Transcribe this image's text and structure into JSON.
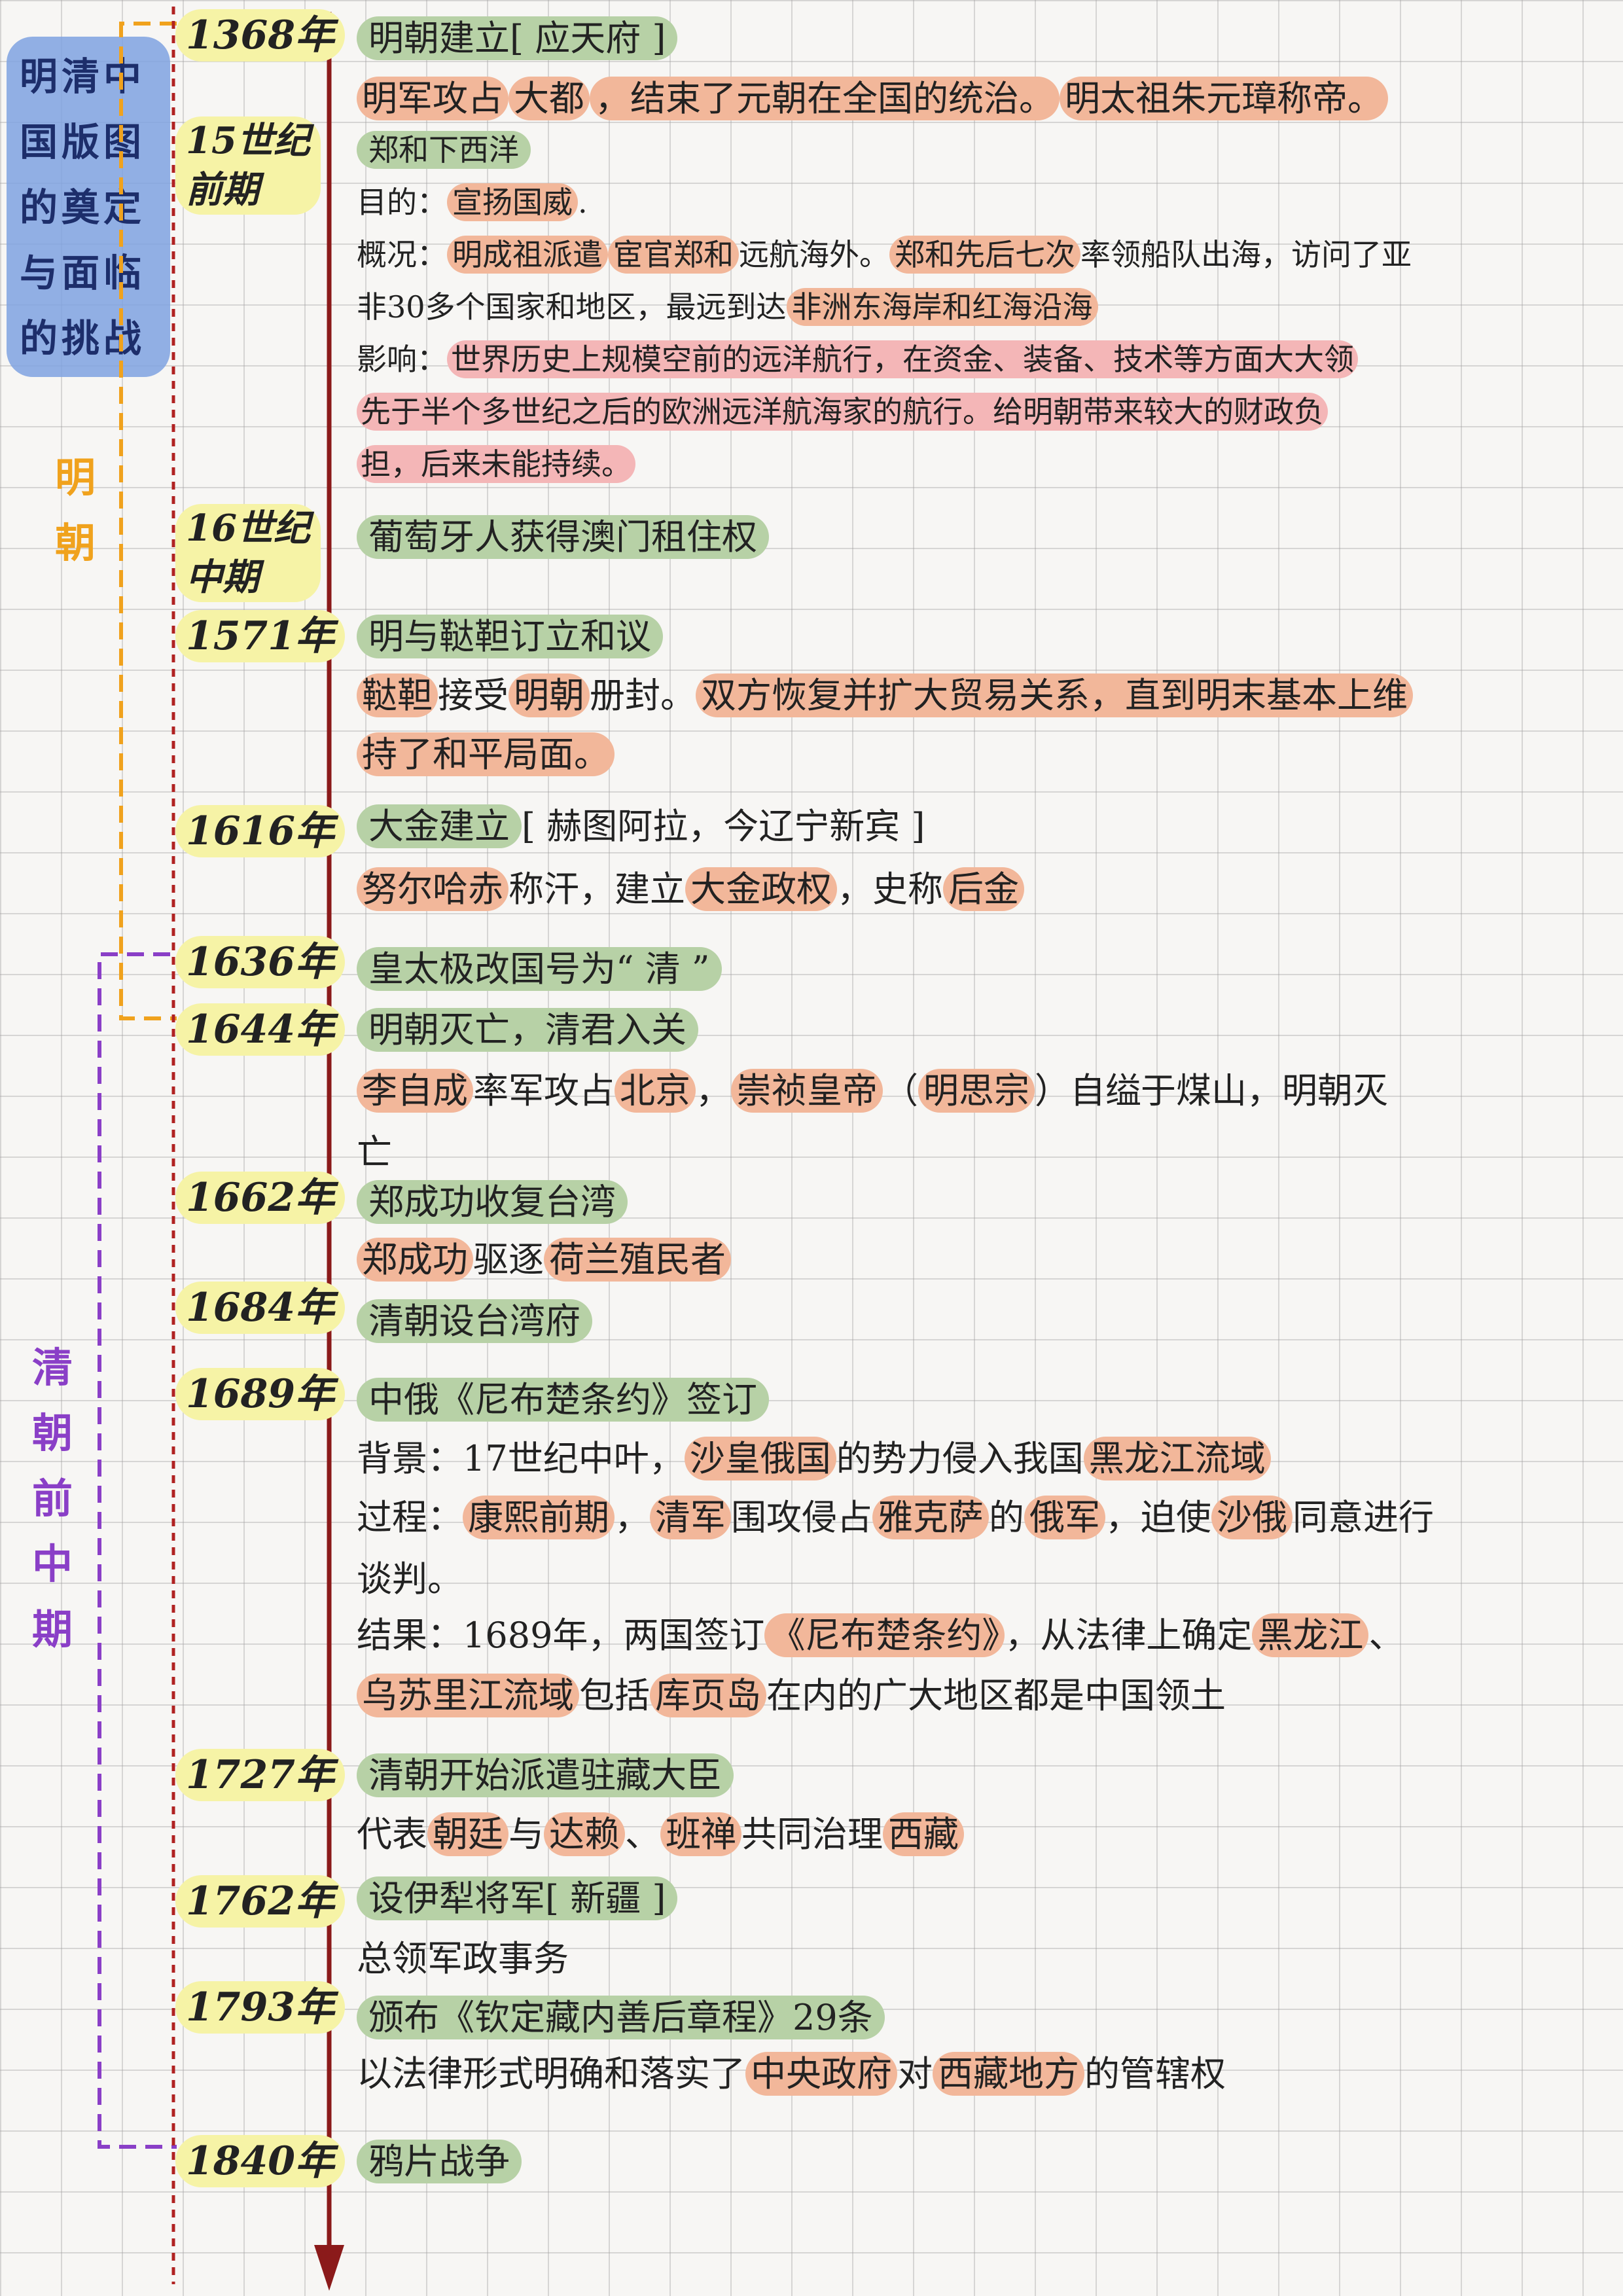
{
  "title": [
    "明清中",
    "国版图",
    "的奠定",
    "与面临",
    "的挑战"
  ],
  "eras": {
    "ming": "明\n朝",
    "qing": "清\n朝\n前\n中\n期"
  },
  "colors": {
    "ming_bracket": "#f0a21d",
    "qing_bracket": "#8a3fc7",
    "axis": "#8b1a1a",
    "green": "#b7d1a6",
    "orange": "#f2b79a",
    "pink": "#f4b6b7",
    "date_bg": "#f6f3a6",
    "title_bg": "#7fa2e0"
  },
  "dates": [
    "1368年",
    "15世纪\n前期",
    "16世纪\n中期",
    "1571年",
    "1616年",
    "1636年",
    "1644年",
    "1662年",
    "1684年",
    "1689年",
    "1727年",
    "1762年",
    "1793年",
    "1840年"
  ],
  "lines": [
    [
      {
        "t": "明朝建立[ 应天府 ]",
        "h": "g"
      }
    ],
    [
      {
        "t": "明军攻占",
        "h": "o"
      },
      {
        "t": "大都",
        "h": "o"
      },
      {
        "t": "，结束了元朝在全国的统治。",
        "h": "o"
      },
      {
        "t": "明太祖朱元璋称帝。",
        "h": "o"
      }
    ],
    [
      {
        "t": "郑和下西洋",
        "h": "g"
      }
    ],
    [
      {
        "t": "目的：",
        "h": ""
      },
      {
        "t": "宣扬国威",
        "h": "o"
      },
      {
        "t": ".",
        "h": ""
      }
    ],
    [
      {
        "t": "概况：",
        "h": ""
      },
      {
        "t": "明成祖派遣",
        "h": "o"
      },
      {
        "t": "宦官郑和",
        "h": "o"
      },
      {
        "t": "远航海外。",
        "h": ""
      },
      {
        "t": "郑和先后七次",
        "h": "o"
      },
      {
        "t": "率领船队出海，访问了亚",
        "h": ""
      }
    ],
    [
      {
        "t": "非30多个国家和地区，最远到达",
        "h": ""
      },
      {
        "t": "非洲东海岸和红海沿海",
        "h": "o"
      }
    ],
    [
      {
        "t": "影响：",
        "h": ""
      },
      {
        "t": "世界历史上规模空前的远洋航行，在资金、装备、技术等方面大大领",
        "h": "p"
      }
    ],
    [
      {
        "t": "先于半个多世纪之后的欧洲远洋航海家的航行。给明朝带来较大的财政负",
        "h": "p"
      }
    ],
    [
      {
        "t": "担，后来未能持续。",
        "h": "p"
      }
    ],
    [
      {
        "t": "葡萄牙人获得澳门租住权",
        "h": "g"
      }
    ],
    [
      {
        "t": "明与鞑靼订立和议",
        "h": "g"
      }
    ],
    [
      {
        "t": "鞑靼",
        "h": "o"
      },
      {
        "t": "接受",
        "h": ""
      },
      {
        "t": "明朝",
        "h": "o"
      },
      {
        "t": "册封。",
        "h": ""
      },
      {
        "t": "双方恢复并扩大贸易关系，直到明末基本上维",
        "h": "o"
      }
    ],
    [
      {
        "t": "持了和平局面。",
        "h": "o"
      }
    ],
    [
      {
        "t": "大金建立",
        "h": "g"
      },
      {
        "t": "[ 赫图阿拉，今辽宁新宾 ]",
        "h": ""
      }
    ],
    [
      {
        "t": "努尔哈赤",
        "h": "o"
      },
      {
        "t": "称汗，建立",
        "h": ""
      },
      {
        "t": "大金政权",
        "h": "o"
      },
      {
        "t": "，史称",
        "h": ""
      },
      {
        "t": "后金",
        "h": "o"
      }
    ],
    [
      {
        "t": "皇太极改国号为“ 清 ”",
        "h": "g"
      }
    ],
    [
      {
        "t": "明朝灭亡，清君入关",
        "h": "g"
      }
    ],
    [
      {
        "t": "李自成",
        "h": "o"
      },
      {
        "t": "率军攻占",
        "h": ""
      },
      {
        "t": "北京",
        "h": "o"
      },
      {
        "t": "，",
        "h": ""
      },
      {
        "t": "崇祯皇帝",
        "h": "o"
      },
      {
        "t": "（",
        "h": ""
      },
      {
        "t": "明思宗",
        "h": "o"
      },
      {
        "t": "）自缢于煤山，明朝灭",
        "h": ""
      }
    ],
    [
      {
        "t": "亡",
        "h": ""
      }
    ],
    [
      {
        "t": "郑成功收复台湾",
        "h": "g"
      }
    ],
    [
      {
        "t": "郑成功",
        "h": "o"
      },
      {
        "t": "驱逐",
        "h": ""
      },
      {
        "t": "荷兰殖民者",
        "h": "o"
      }
    ],
    [
      {
        "t": "清朝设台湾府",
        "h": "g"
      }
    ],
    [
      {
        "t": "中俄《尼布楚条约》签订",
        "h": "g"
      }
    ],
    [
      {
        "t": "背景：17世纪中叶，",
        "h": ""
      },
      {
        "t": "沙皇俄国",
        "h": "o"
      },
      {
        "t": "的势力侵入我国",
        "h": ""
      },
      {
        "t": "黑龙江流域",
        "h": "o"
      }
    ],
    [
      {
        "t": "过程：",
        "h": ""
      },
      {
        "t": "康熙前期",
        "h": "o"
      },
      {
        "t": "，",
        "h": ""
      },
      {
        "t": "清军",
        "h": "o"
      },
      {
        "t": "围攻侵占",
        "h": ""
      },
      {
        "t": "雅克萨",
        "h": "o"
      },
      {
        "t": "的",
        "h": ""
      },
      {
        "t": "俄军",
        "h": "o"
      },
      {
        "t": "，迫使",
        "h": ""
      },
      {
        "t": "沙俄",
        "h": "o"
      },
      {
        "t": "同意进行",
        "h": ""
      }
    ],
    [
      {
        "t": "谈判。",
        "h": ""
      }
    ],
    [
      {
        "t": "结果：1689年，两国签订",
        "h": ""
      },
      {
        "t": "《尼布楚条约》",
        "h": "o"
      },
      {
        "t": "，从法律上确定",
        "h": ""
      },
      {
        "t": "黑龙江",
        "h": "o"
      },
      {
        "t": "、",
        "h": ""
      }
    ],
    [
      {
        "t": "乌苏里江流域",
        "h": "o"
      },
      {
        "t": "包括",
        "h": ""
      },
      {
        "t": "库页岛",
        "h": "o"
      },
      {
        "t": "在内的广大地区都是中国领土",
        "h": ""
      }
    ],
    [
      {
        "t": "清朝开始派遣驻藏大臣",
        "h": "g"
      }
    ],
    [
      {
        "t": "代表",
        "h": ""
      },
      {
        "t": "朝廷",
        "h": "o"
      },
      {
        "t": "与",
        "h": ""
      },
      {
        "t": "达赖",
        "h": "o"
      },
      {
        "t": "、",
        "h": ""
      },
      {
        "t": "班禅",
        "h": "o"
      },
      {
        "t": "共同治理",
        "h": ""
      },
      {
        "t": "西藏",
        "h": "o"
      }
    ],
    [
      {
        "t": "设伊犁将军[ 新疆 ]",
        "h": "g"
      }
    ],
    [
      {
        "t": "总领军政事务",
        "h": ""
      }
    ],
    [
      {
        "t": "颁布《钦定藏内善后章程》29条",
        "h": "g"
      }
    ],
    [
      {
        "t": "以法律形式明确和落实了",
        "h": ""
      },
      {
        "t": "中央政府",
        "h": "o"
      },
      {
        "t": "对",
        "h": ""
      },
      {
        "t": "西藏地方",
        "h": "o"
      },
      {
        "t": "的管辖权",
        "h": ""
      }
    ],
    [
      {
        "t": "鸦片战争",
        "h": "g"
      }
    ]
  ]
}
